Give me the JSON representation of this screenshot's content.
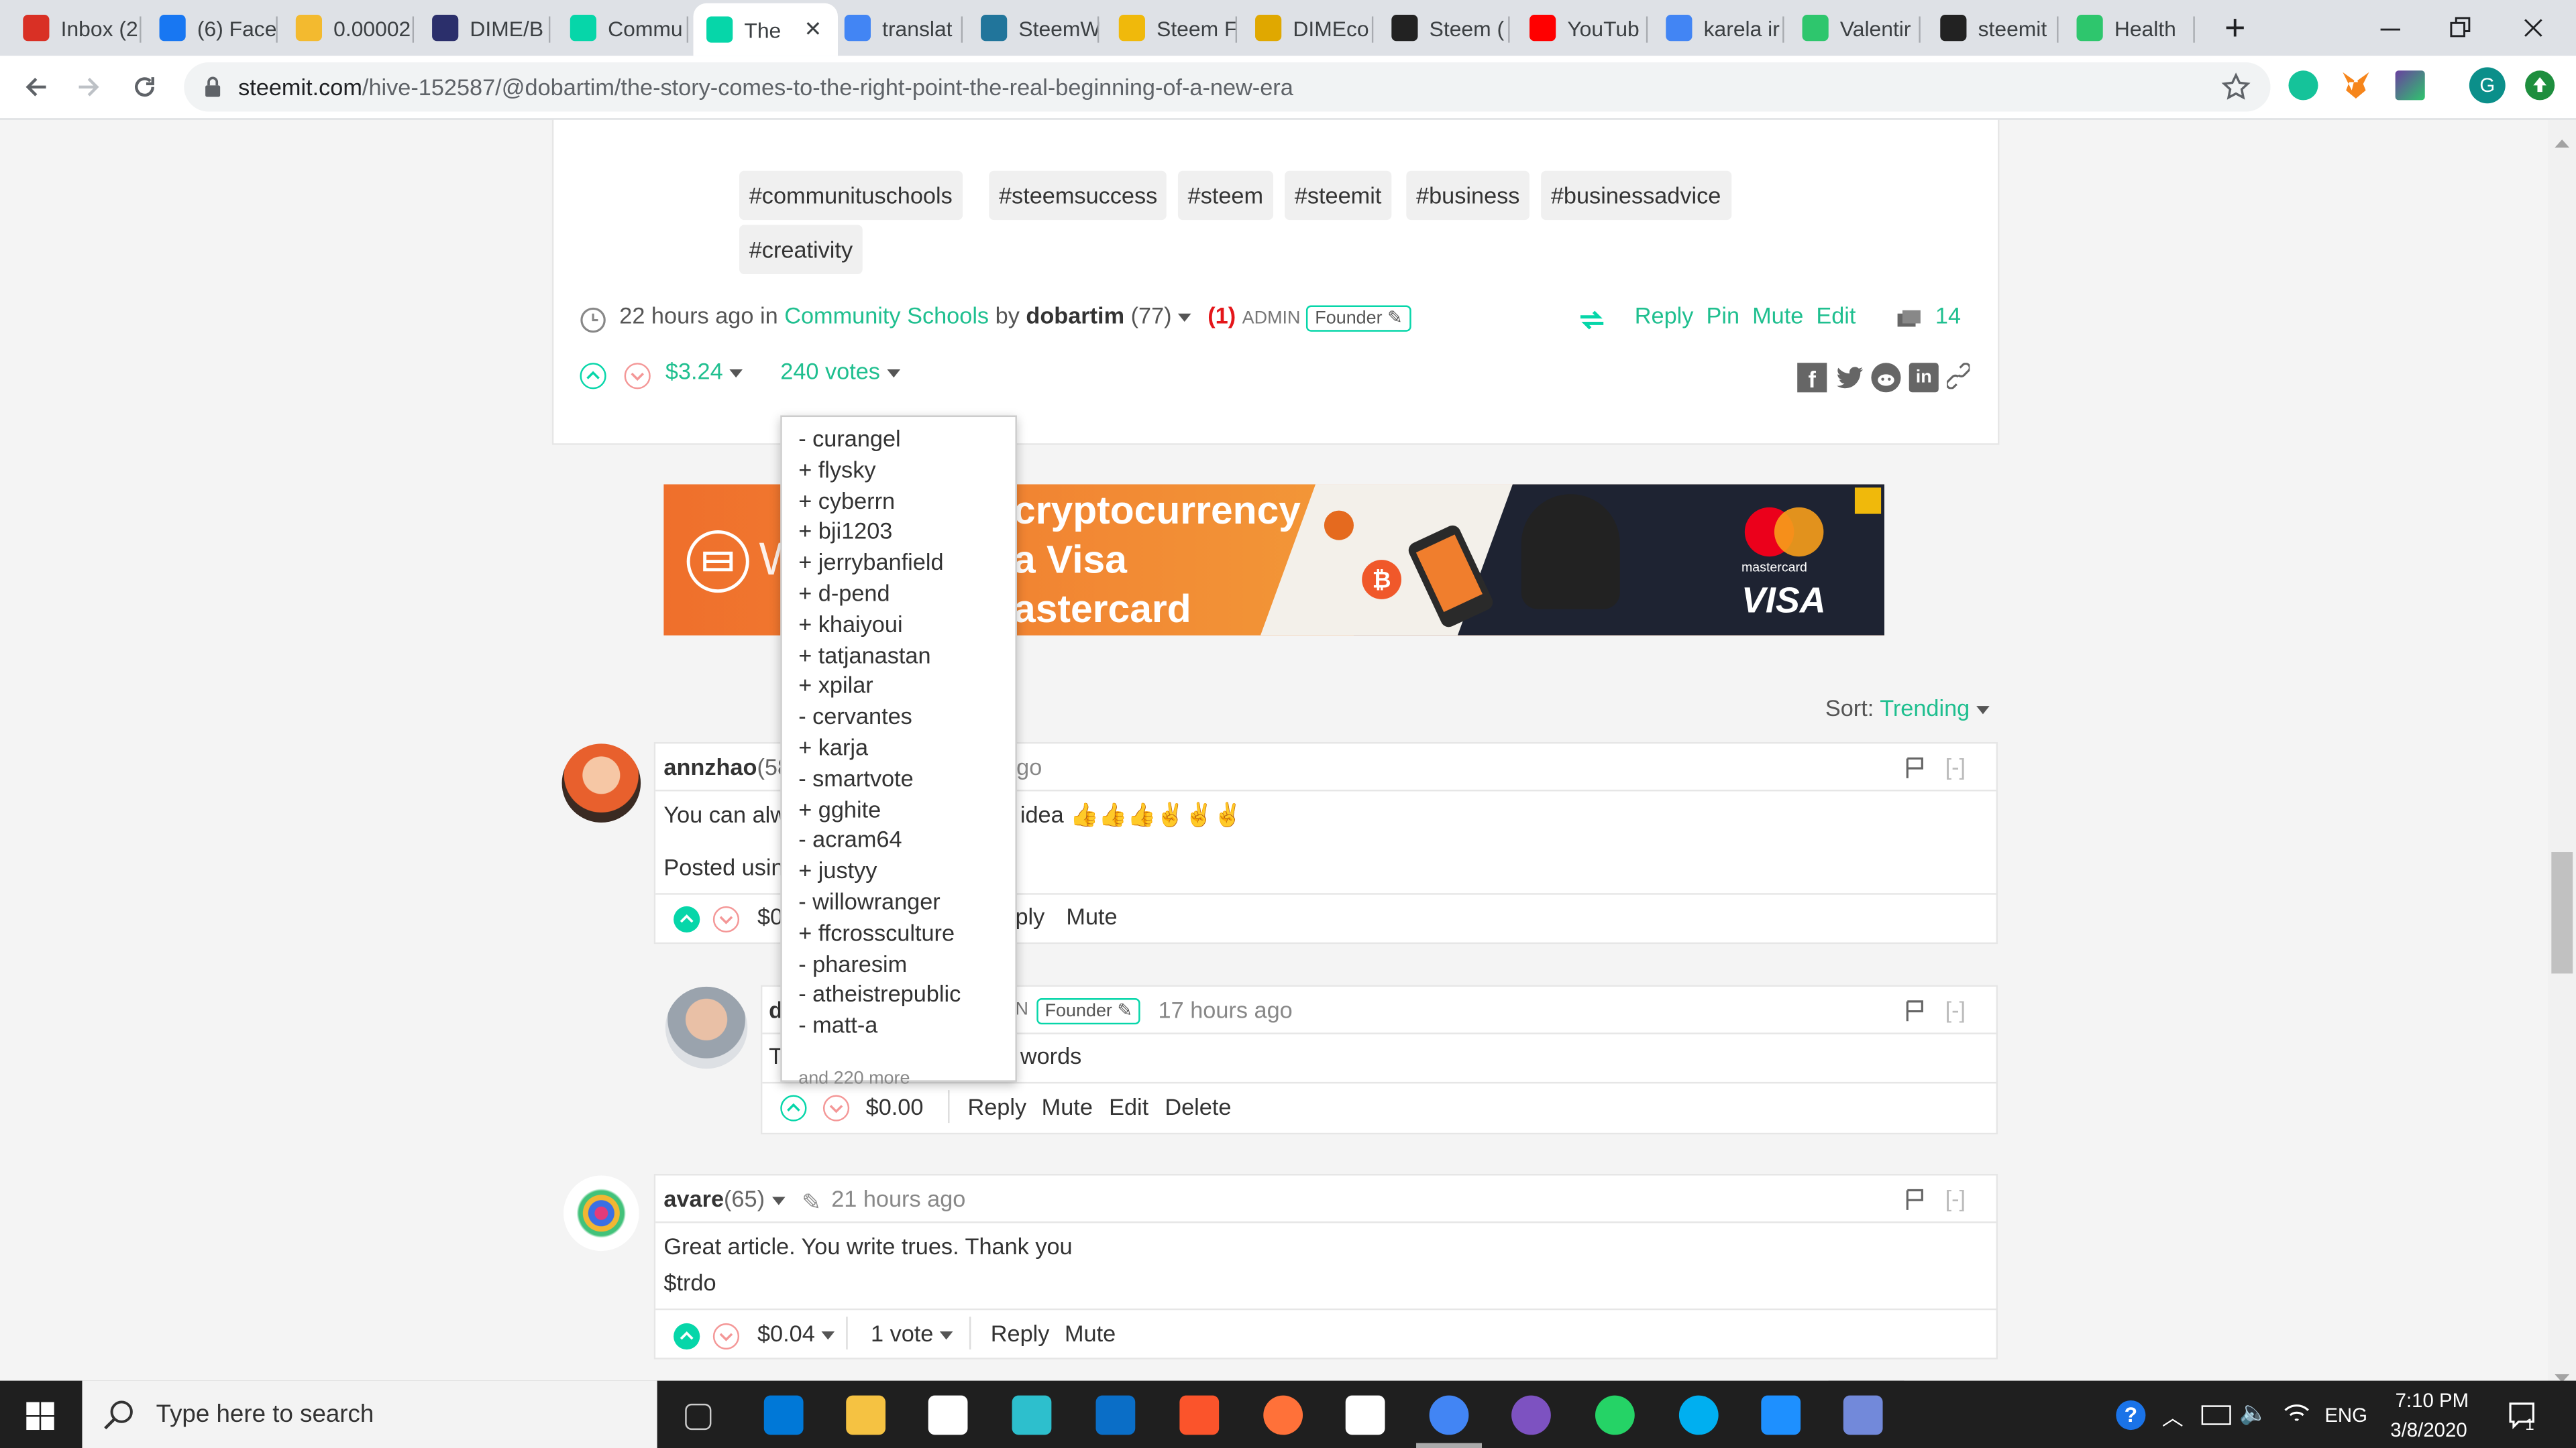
{
  "browser": {
    "tabs": [
      {
        "label": "Inbox (2",
        "icon": "gmail-icon",
        "color": "#d93025"
      },
      {
        "label": "(6) Face",
        "icon": "facebook-icon",
        "color": "#1877f2"
      },
      {
        "label": "0.00002",
        "icon": "binance-icon",
        "color": "#f3ba2f"
      },
      {
        "label": "DIME/B",
        "icon": "dime-icon",
        "color": "#2b2f6b"
      },
      {
        "label": "Commu",
        "icon": "steemit-icon",
        "color": "#06d6a9"
      },
      {
        "label": "The",
        "icon": "steemit-icon",
        "color": "#06d6a9"
      },
      {
        "label": "translat",
        "icon": "google-icon",
        "color": "#4285f4"
      },
      {
        "label": "SteemW",
        "icon": "wordpress-icon",
        "color": "#21759b"
      },
      {
        "label": "Steem F",
        "icon": "steem-icon",
        "color": "#f0b90b"
      },
      {
        "label": "DIMEco",
        "icon": "coin-icon",
        "color": "#e0a800"
      },
      {
        "label": "Steem (",
        "icon": "coinmarket-icon",
        "color": "#222222"
      },
      {
        "label": "YouTub",
        "icon": "youtube-icon",
        "color": "#ff0000"
      },
      {
        "label": "karela ir",
        "icon": "google-icon",
        "color": "#4285f4"
      },
      {
        "label": "Valentir",
        "icon": "pixabay-icon",
        "color": "#2ec66d"
      },
      {
        "label": "steemit",
        "icon": "steemit-dark-icon",
        "color": "#222222"
      },
      {
        "label": "Health",
        "icon": "health-icon",
        "color": "#2ec66d"
      }
    ],
    "close_glyph": "✕",
    "new_tab_glyph": "+",
    "url_host": "steemit.com",
    "url_path": "/hive-152587/@dobartim/the-story-comes-to-the-right-point-the-real-beginning-of-a-new-era"
  },
  "post": {
    "tags": [
      "#communituschools",
      "#steemsuccess",
      "#steem",
      "#steemit",
      "#business",
      "#businessadvice",
      "#creativity"
    ],
    "time": "22 hours ago in",
    "community": "Community Schools",
    "by": "by",
    "author": "dobartim",
    "rep": "(77)",
    "role_num": "(1)",
    "role": "ADMIN",
    "badge": "Founder",
    "actions": [
      "Reply",
      "Pin",
      "Mute",
      "Edit"
    ],
    "comment_count": "14",
    "payout": "$3.24",
    "votes": "240 votes"
  },
  "voters": {
    "list": [
      "- curangel",
      "+ flysky",
      "+ cyberrn",
      "+ bji1203",
      "+ jerrybanfield",
      "+ d-pend",
      "+ khaiyoui",
      "+ tatjanastan",
      "+ xpilar",
      "- cervantes",
      "+ karja",
      "- smartvote",
      "+ gghite",
      "- acram64",
      "+ justyy",
      "- willowranger",
      "+ ffcrossculture",
      "- pharesim",
      "- atheistrepublic",
      "- matt-a"
    ],
    "more": "and 220 more"
  },
  "banner": {
    "line1": "cryptocurrency",
    "line2": "a Visa",
    "line3": "astercard",
    "letter": "W",
    "mastercard": "mastercard",
    "visa": "VISA"
  },
  "sort": {
    "label": "Sort:",
    "value": "Trending"
  },
  "comments": [
    {
      "author": "annzhao",
      "rep": "(58",
      "time": "s ago",
      "text1": "You can alw",
      "text1b": "idea 👍👍👍✌✌✌",
      "text2": "Posted usin",
      "payout": "$0",
      "actions": [
        "ply",
        "Mute"
      ],
      "collapse": "[-]"
    },
    {
      "author": "d",
      "role_suffix": "N",
      "badge": "Founder",
      "time": "17 hours ago",
      "text1": "T",
      "text1b": "words",
      "payout": "$0.00",
      "actions": [
        "Reply",
        "Mute",
        "Edit",
        "Delete"
      ],
      "collapse": "[-]"
    },
    {
      "author": "avare",
      "rep": "(65)",
      "time": "21 hours ago",
      "text1": "Great article. You write trues. Thank you",
      "text2": "$trdo",
      "payout": "$0.04",
      "votes": "1 vote",
      "actions": [
        "Reply",
        "Mute"
      ],
      "collapse": "[-]"
    }
  ],
  "taskbar": {
    "search_placeholder": "Type here to search",
    "lang": "ENG",
    "time": "7:10 PM",
    "date": "3/8/2020",
    "notif_count": "1"
  },
  "colors": {
    "steem_green": "#06d6a9",
    "link_green": "#1fbf8f",
    "downvote": "#f49797",
    "banner_orange": "#f07e2d"
  }
}
